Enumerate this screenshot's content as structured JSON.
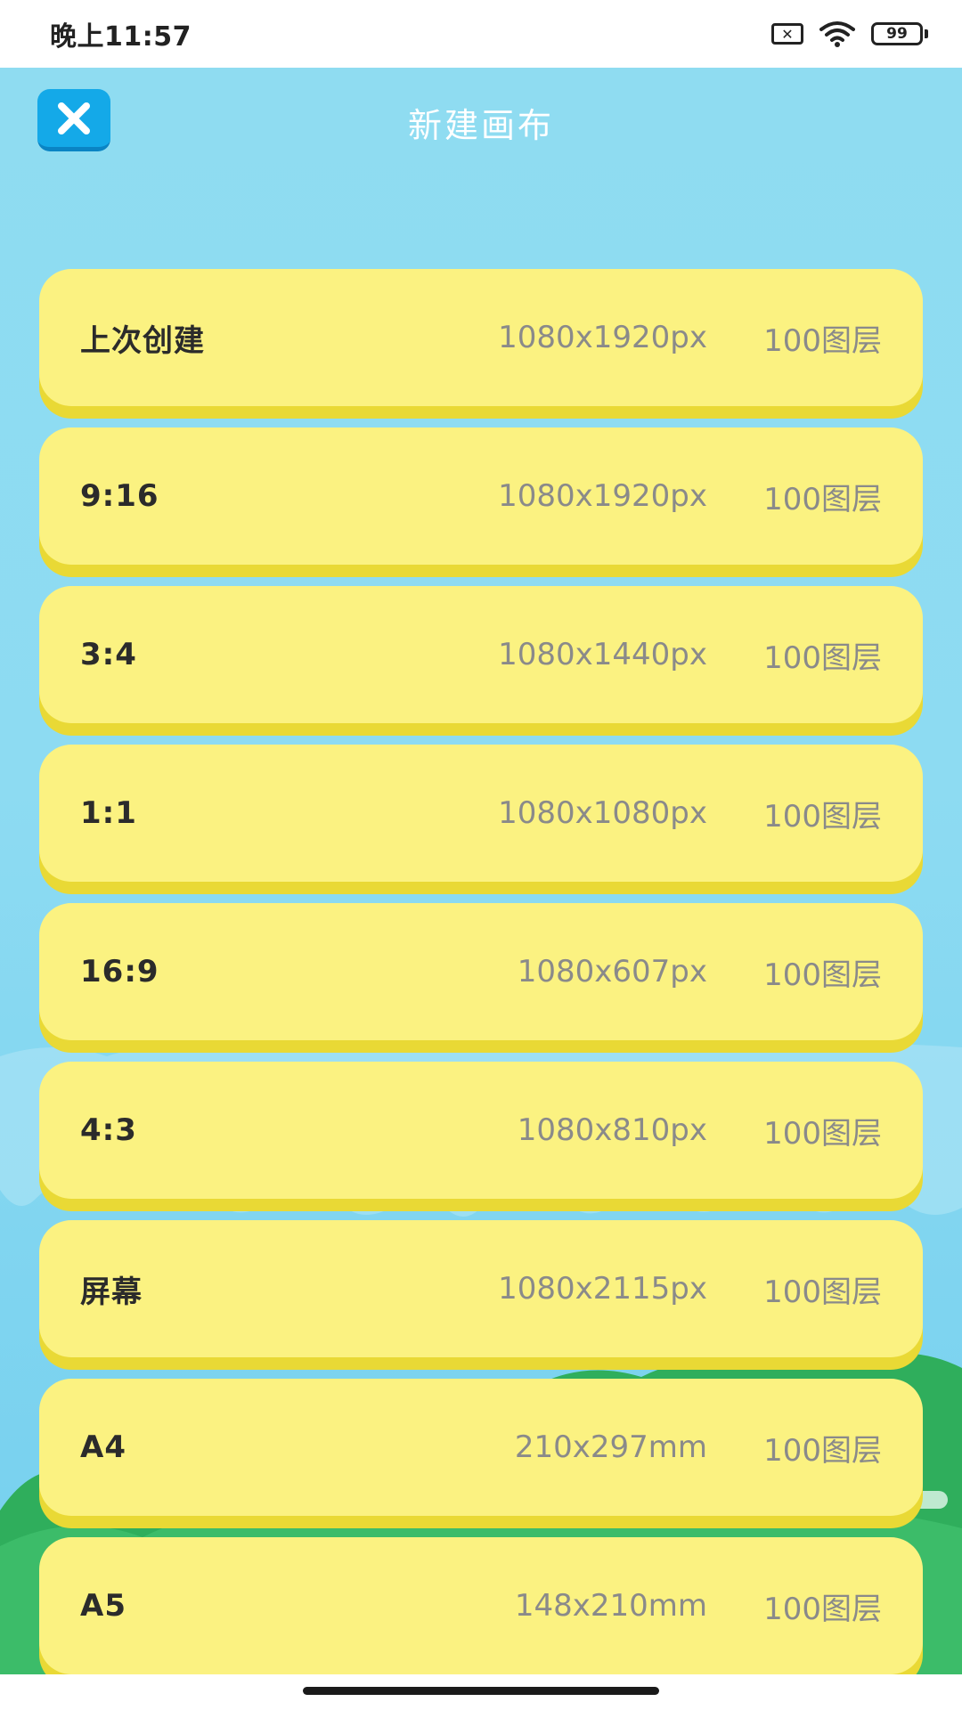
{
  "status_bar": {
    "time": "晚上11:57",
    "battery": "99"
  },
  "header": {
    "title": "新建画布",
    "close_icon": "close-icon"
  },
  "presets": [
    {
      "name": "上次创建",
      "size": "1080x1920px",
      "layers": "100图层"
    },
    {
      "name": "9:16",
      "size": "1080x1920px",
      "layers": "100图层"
    },
    {
      "name": "3:4",
      "size": "1080x1440px",
      "layers": "100图层"
    },
    {
      "name": "1:1",
      "size": "1080x1080px",
      "layers": "100图层"
    },
    {
      "name": "16:9",
      "size": "1080x607px",
      "layers": "100图层"
    },
    {
      "name": "4:3",
      "size": "1080x810px",
      "layers": "100图层"
    },
    {
      "name": "屏幕",
      "size": "1080x2115px",
      "layers": "100图层"
    },
    {
      "name": "A4",
      "size": "210x297mm",
      "layers": "100图层"
    },
    {
      "name": "A5",
      "size": "148x210mm",
      "layers": "100图层"
    }
  ],
  "colors": {
    "background": "#8ddbf2",
    "card": "#fbf281",
    "card_edge": "#e9d935",
    "close_button": "#14a9e8",
    "hills": "#2fae5c"
  }
}
